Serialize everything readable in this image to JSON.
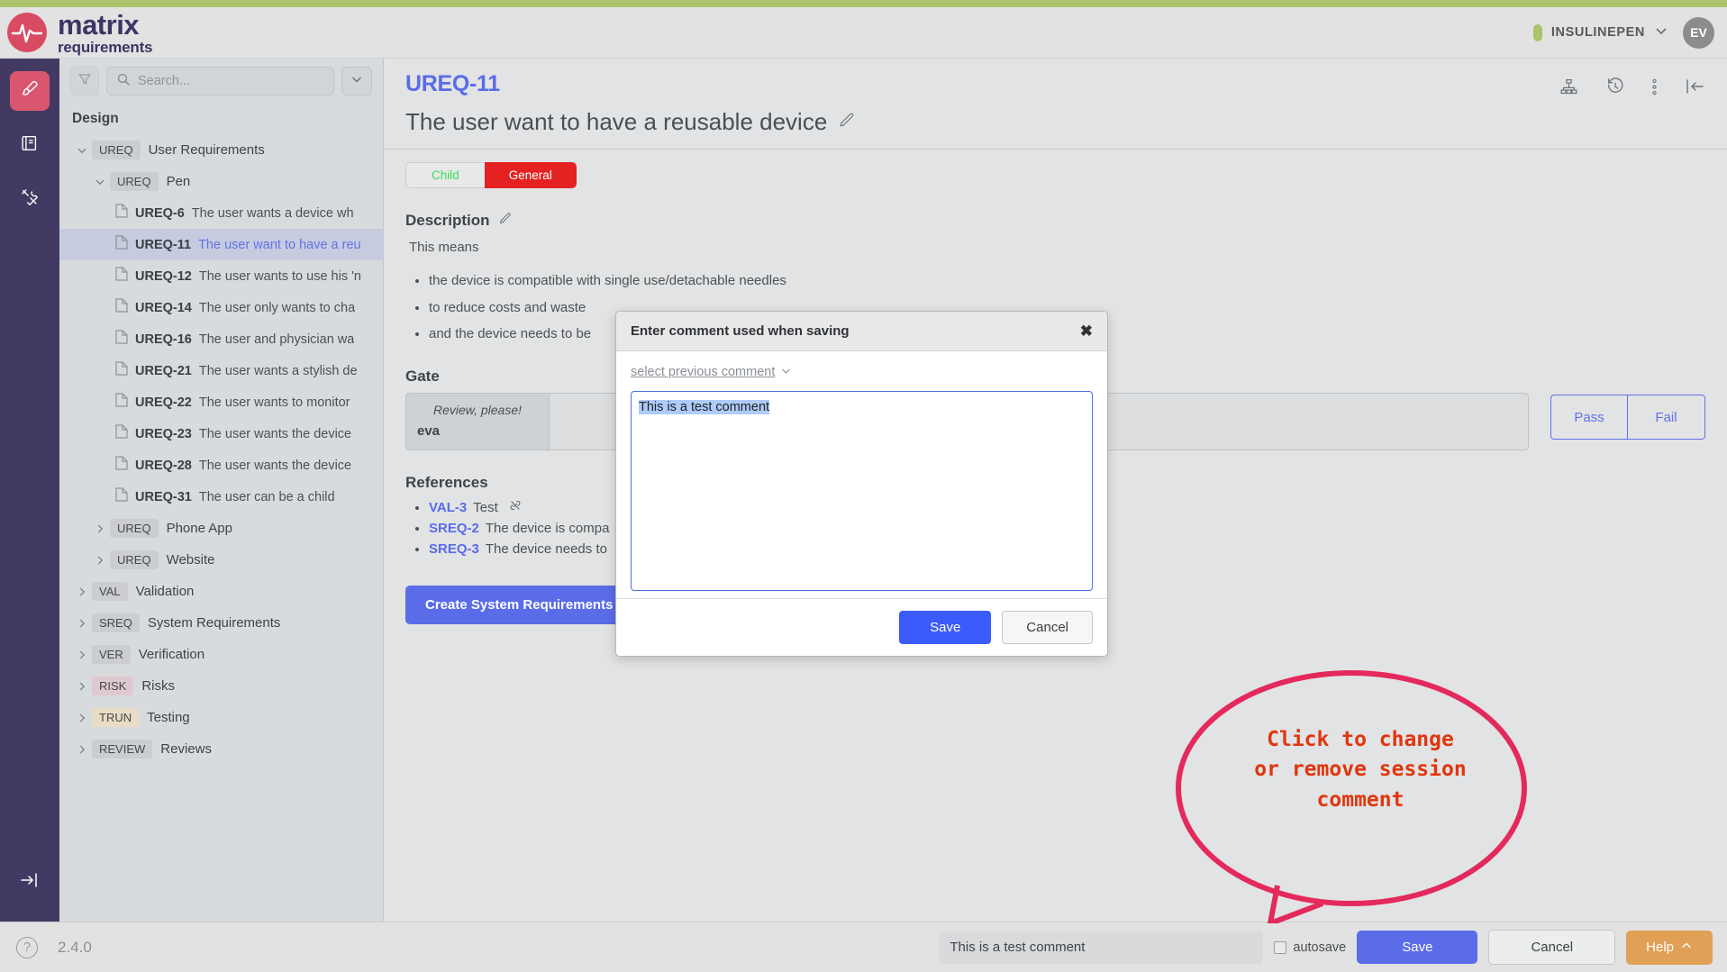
{
  "brand": {
    "logo_line1": "matrix",
    "logo_line2": "requirements",
    "logo_icon": "pulse-circle-icon"
  },
  "header": {
    "project_name": "INSULINEPEN",
    "project_chevron": "chevron-down-icon",
    "avatar_initials": "EV"
  },
  "rail": {
    "items": [
      {
        "icon": "paintbrush-icon",
        "active": true
      },
      {
        "icon": "book-icon",
        "active": false
      },
      {
        "icon": "tools-icon",
        "active": false
      }
    ],
    "collapse_icon": "collapse-right-icon"
  },
  "sidebar": {
    "filter_icon": "filter-icon",
    "search_icon": "search-icon",
    "search_placeholder": "Search...",
    "search_value": "",
    "dropdown_icon": "chevron-down-icon",
    "section_title": "Design",
    "tree": [
      {
        "level": 0,
        "twist": "chevron-down-icon",
        "badge": "UREQ",
        "badge_kind": "default",
        "label": "User Requirements"
      },
      {
        "level": 1,
        "twist": "chevron-down-icon",
        "badge": "UREQ",
        "badge_kind": "default",
        "label": "Pen"
      },
      {
        "level": 2,
        "icon": "document-icon",
        "id": "UREQ-6",
        "text": "The user wants a device wh",
        "selected": false
      },
      {
        "level": 2,
        "icon": "document-icon",
        "id": "UREQ-11",
        "text": "The user want to have a reu",
        "selected": true
      },
      {
        "level": 2,
        "icon": "document-icon",
        "id": "UREQ-12",
        "text": "The user wants to use his 'n",
        "selected": false
      },
      {
        "level": 2,
        "icon": "document-icon",
        "id": "UREQ-14",
        "text": "The user only wants to cha",
        "selected": false
      },
      {
        "level": 2,
        "icon": "document-icon",
        "id": "UREQ-16",
        "text": "The user and physician wa",
        "selected": false
      },
      {
        "level": 2,
        "icon": "document-icon",
        "id": "UREQ-21",
        "text": "The user wants a stylish de",
        "selected": false
      },
      {
        "level": 2,
        "icon": "document-icon",
        "id": "UREQ-22",
        "text": "The user wants to monitor",
        "selected": false
      },
      {
        "level": 2,
        "icon": "document-icon",
        "id": "UREQ-23",
        "text": "The user wants the device",
        "selected": false
      },
      {
        "level": 2,
        "icon": "document-icon",
        "id": "UREQ-28",
        "text": "The user wants the device",
        "selected": false
      },
      {
        "level": 2,
        "icon": "document-icon",
        "id": "UREQ-31",
        "text": "The user can be a child",
        "selected": false
      },
      {
        "level": 1,
        "twist": "chevron-right-icon",
        "badge": "UREQ",
        "badge_kind": "default",
        "label": "Phone App"
      },
      {
        "level": 1,
        "twist": "chevron-right-icon",
        "badge": "UREQ",
        "badge_kind": "default",
        "label": "Website"
      },
      {
        "level": 0,
        "twist": "chevron-right-icon",
        "badge": "VAL",
        "badge_kind": "default",
        "label": "Validation"
      },
      {
        "level": 0,
        "twist": "chevron-right-icon",
        "badge": "SREQ",
        "badge_kind": "default",
        "label": "System Requirements"
      },
      {
        "level": 0,
        "twist": "chevron-right-icon",
        "badge": "VER",
        "badge_kind": "default",
        "label": "Verification"
      },
      {
        "level": 0,
        "twist": "chevron-right-icon",
        "badge": "RISK",
        "badge_kind": "risk",
        "label": "Risks"
      },
      {
        "level": 0,
        "twist": "chevron-right-icon",
        "badge": "TRUN",
        "badge_kind": "trun",
        "label": "Testing"
      },
      {
        "level": 0,
        "twist": "chevron-right-icon",
        "badge": "REVIEW",
        "badge_kind": "default",
        "label": "Reviews"
      }
    ]
  },
  "main": {
    "doc_id": "UREQ-11",
    "doc_title": "The user want to have a reusable device",
    "title_edit_icon": "pencil-icon",
    "head_icons": [
      "hierarchy-icon",
      "history-icon",
      "more-vertical-icon",
      "collapse-left-icon"
    ],
    "segmented": {
      "left": "Child",
      "right": "General"
    },
    "description": {
      "heading": "Description",
      "edit_icon": "pencil-icon",
      "intro": "This means",
      "bullets": [
        "the device is compatible with single use/detachable needles",
        "to reduce costs and waste",
        "and the device needs to be"
      ]
    },
    "gate": {
      "heading": "Gate",
      "question": "Review, please!",
      "user": "eva",
      "pass_label": "Pass",
      "fail_label": "Fail"
    },
    "references": {
      "heading": "References",
      "items": [
        {
          "id": "VAL-3",
          "text": "Test",
          "icon": "unlink-icon"
        },
        {
          "id": "SREQ-2",
          "text": "The device is compa"
        },
        {
          "id": "SREQ-3",
          "text": "The device needs to"
        }
      ]
    },
    "create_button": "Create System Requirements"
  },
  "modal": {
    "title": "Enter comment used when saving",
    "close_icon": "close-icon",
    "previous_comment_link": "select previous comment",
    "previous_comment_chevron": "chevron-down-icon",
    "textarea_value": "This is a test comment",
    "save_label": "Save",
    "cancel_label": "Cancel"
  },
  "annotation": {
    "line1": "Click to change",
    "line2": "or remove session",
    "line3": "comment",
    "bubble_color": "#e4295c",
    "text_color": "#e0360e"
  },
  "bottombar": {
    "help_icon": "question-circle-icon",
    "version": "2.4.0",
    "comment_value": "This is a test comment",
    "autosave_label": "autosave",
    "autosave_checked": false,
    "save_label": "Save",
    "cancel_label": "Cancel",
    "help_label": "Help",
    "help_chevron": "chevron-up-icon"
  }
}
